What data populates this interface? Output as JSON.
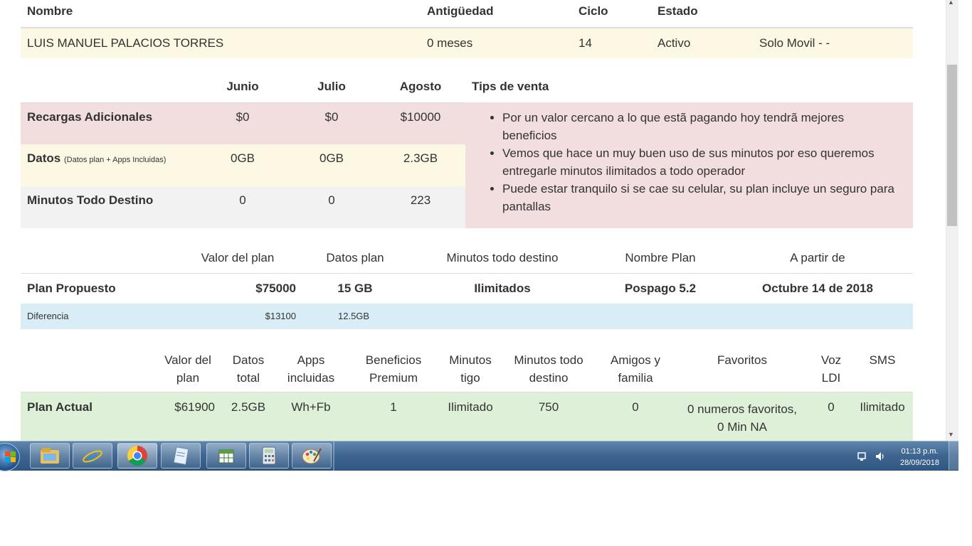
{
  "customer": {
    "headers": [
      "Nombre",
      "Antigüedad",
      "Ciclo",
      "Estado"
    ],
    "name": "LUIS MANUEL PALACIOS TORRES",
    "antiguedad": "0 meses",
    "ciclo": "14",
    "estado": "Activo",
    "extra": "Solo Movil - -"
  },
  "usage": {
    "months": [
      "Junio",
      "Julio",
      "Agosto"
    ],
    "tips_header": "Tips de venta",
    "rows": [
      {
        "label": "Recargas Adicionales",
        "sub": "",
        "values": [
          "$0",
          "$0",
          "$10000"
        ]
      },
      {
        "label": "Datos",
        "sub": "(Datos plan + Apps Incluidas)",
        "values": [
          "0GB",
          "0GB",
          "2.3GB"
        ]
      },
      {
        "label": "Minutos Todo Destino",
        "sub": "",
        "values": [
          "0",
          "0",
          "223"
        ]
      }
    ],
    "tips": [
      "Por un valor cercano a lo que estã pagando hoy tendrã mejores beneficios",
      "Vemos que hace un muy buen uso de sus minutos por eso queremos entregarle minutos ilimitados a todo operador",
      "Puede estar tranquilo si se cae su celular, su plan incluye un seguro para pantallas"
    ]
  },
  "proposed": {
    "headers": [
      "Valor del plan",
      "Datos plan",
      "Minutos todo destino",
      "Nombre Plan",
      "A partir de"
    ],
    "label": "Plan Propuesto",
    "valor": "$75000",
    "datos": "15 GB",
    "minutos": "Ilimitados",
    "nombre": "Pospago 5.2",
    "fecha": "Octubre 14 de 2018",
    "diff_label": "Diferencia",
    "diff_valor": "$13100",
    "diff_datos": "12.5GB"
  },
  "current": {
    "headers": [
      [
        "Valor del",
        "plan"
      ],
      [
        "Datos",
        "total"
      ],
      [
        "Apps",
        "incluidas"
      ],
      [
        "Beneficios",
        "Premium"
      ],
      [
        "Minutos",
        "tigo"
      ],
      [
        "Minutos todo",
        "destino"
      ],
      [
        "Amigos y",
        "familia"
      ],
      [
        "Favoritos",
        ""
      ],
      [
        "Voz",
        "LDI"
      ],
      [
        "SMS",
        ""
      ]
    ],
    "label": "Plan Actual",
    "values": [
      "$61900",
      "2.5GB",
      "Wh+Fb",
      "1",
      "Ilimitado",
      "750",
      "0",
      "0 numeros favoritos,",
      "0",
      "Ilimitado"
    ],
    "favoritos_line2": "0 Min NA"
  },
  "taskbar": {
    "apps": [
      "file-explorer-icon",
      "internet-explorer-icon",
      "chrome-icon",
      "notepad-icon",
      "spreadsheet-icon",
      "calculator-icon",
      "paint-icon"
    ],
    "time": "01:13 p.m.",
    "date": "28/09/2018"
  }
}
